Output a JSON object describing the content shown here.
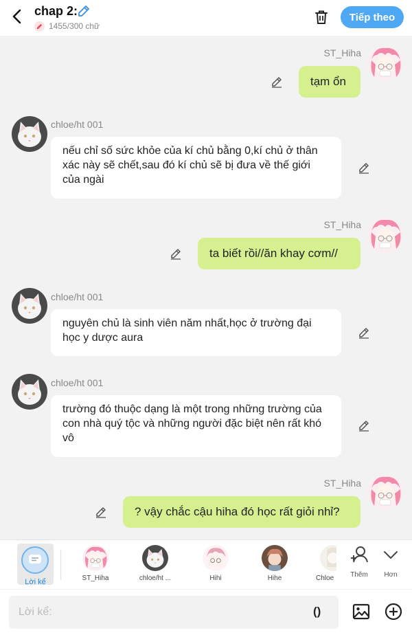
{
  "header": {
    "title": "chap 2:",
    "word_count": "1455/300 chữ",
    "next_label": "Tiếp theo"
  },
  "messages": [
    {
      "side": "right",
      "sender": "ST_Hiha",
      "text": "tạm ổn"
    },
    {
      "side": "left",
      "sender": "chloe/ht 001",
      "text": "nếu chỉ số sức khỏe của kí chủ bằng 0,kí chủ ở thân xác này sẽ chết,sau đó kí chủ sẽ bị đưa về thế giới của ngài"
    },
    {
      "side": "right",
      "sender": "ST_Hiha",
      "text": "ta biết rồi//ăn khay cơm//"
    },
    {
      "side": "left",
      "sender": "chloe/ht 001",
      "text": "nguyên chủ là sinh viên năm nhất,học ở trường đại học y dược aura"
    },
    {
      "side": "left",
      "sender": "chloe/ht 001",
      "text": "trường đó thuộc dạng là một trong những trường của con nhà quý tộc và những người đặc biệt nên rất khó vô"
    },
    {
      "side": "right",
      "sender": "ST_Hiha",
      "text": "? vậy chắc cậu hiha đó học rất giỏi nhỉ?"
    }
  ],
  "character_bar": {
    "narration_label": "Lời kể",
    "characters": [
      "ST_Hiha",
      "chloe/ht ...",
      "Hihi",
      "Hihe",
      "Chloe"
    ],
    "add_label": "Thêm",
    "more_label": "Hơn"
  },
  "input": {
    "placeholder": "Lời kể:",
    "paren_label": "()"
  },
  "colors": {
    "accent": "#4ea8f3",
    "right_bubble": "#d6f08f",
    "left_bubble": "#ffffff",
    "background": "#f2f2f2"
  }
}
